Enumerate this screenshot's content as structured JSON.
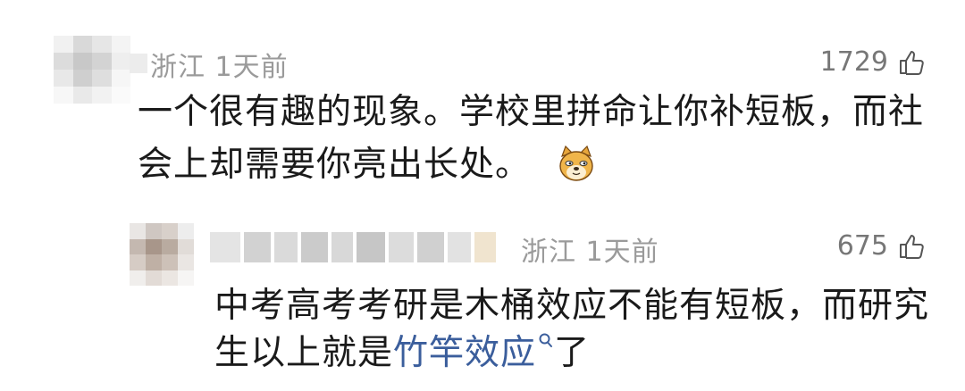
{
  "comment": {
    "location": "浙江",
    "time": "1天前",
    "likes": "1729",
    "text_line_1": "一个很有趣的现象。学校里拼命让你补短板，而社",
    "text_line_2": "会上却需要你亮出长处。",
    "emoji": "doge-emoji"
  },
  "reply": {
    "location": "浙江",
    "time": "1天前",
    "likes": "675",
    "text_line_1": "中考高考考研是木桶效应不能有短板，而研究",
    "text_prefix_2": "生以上就是",
    "topic_link": "竹竿效应",
    "text_suffix_2": "了"
  },
  "colors": {
    "meta_gray": "#9a9a9a",
    "link_blue": "#3b5e9c",
    "text_dark": "#1a1a1a"
  },
  "icons": {
    "like": "thumbs-up-icon",
    "search": "search-icon"
  }
}
